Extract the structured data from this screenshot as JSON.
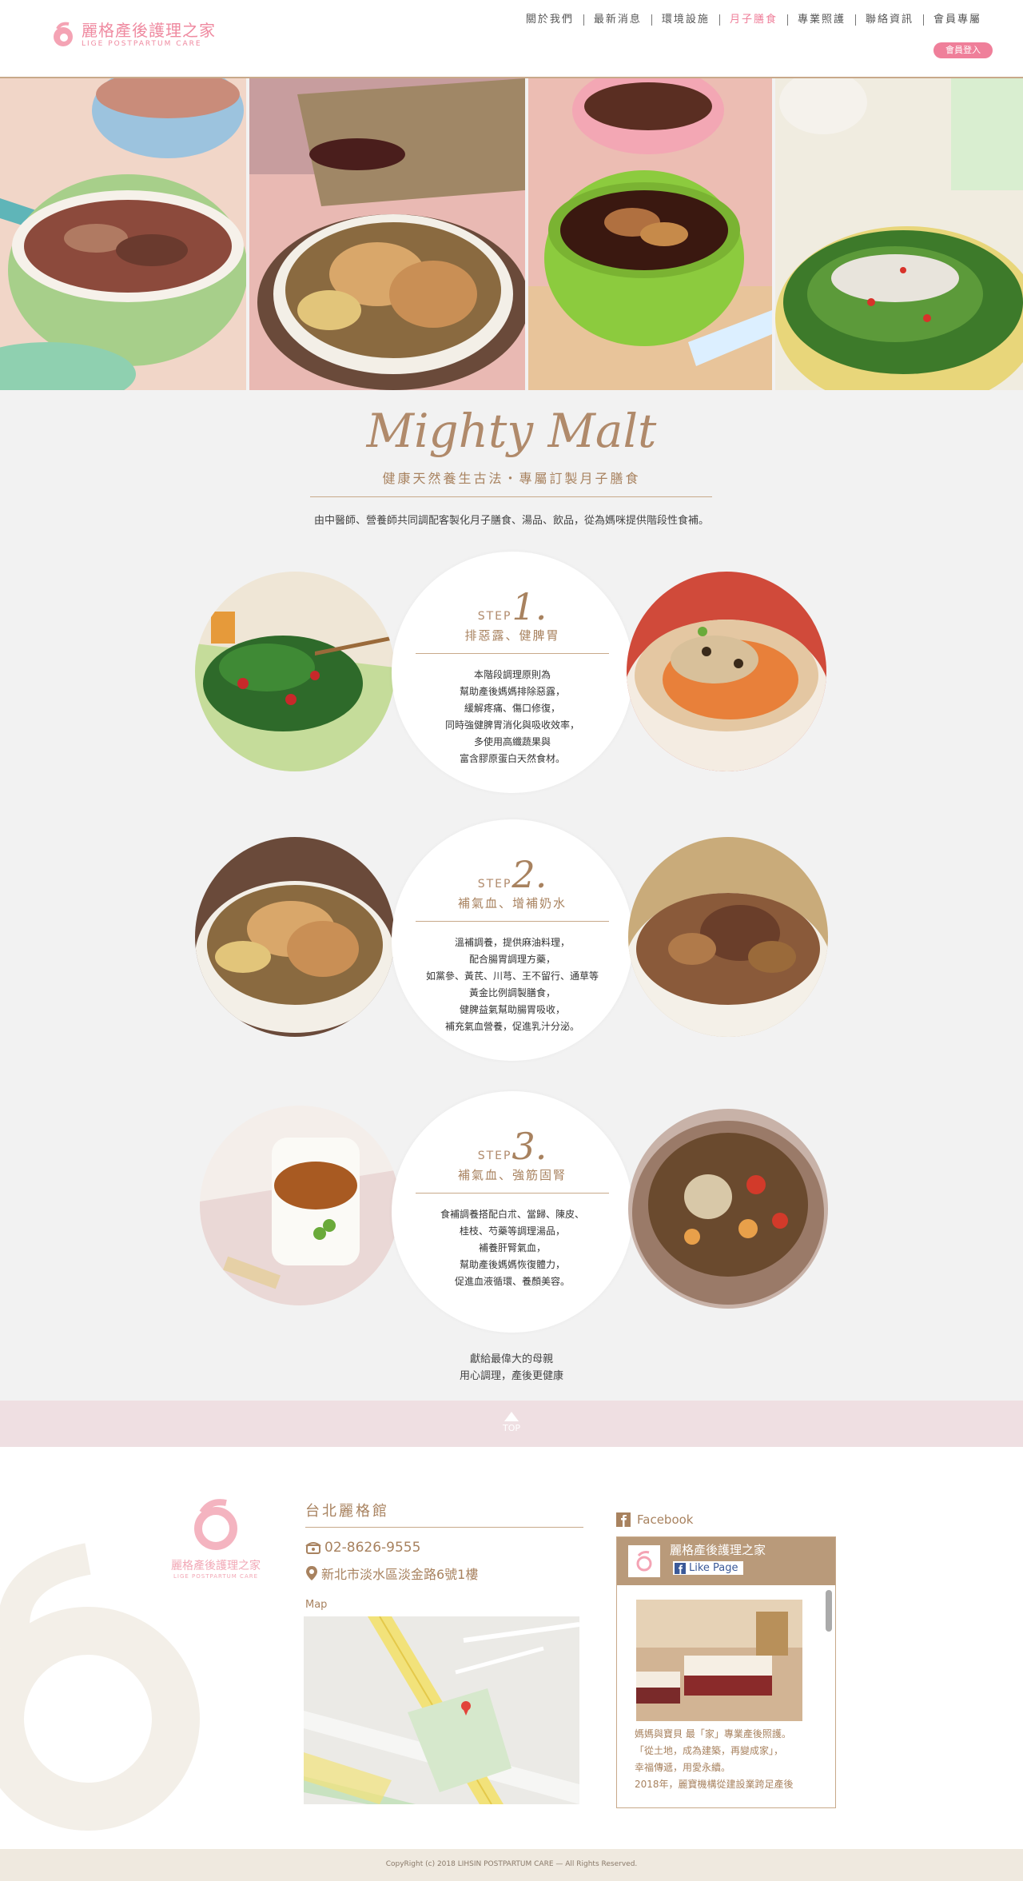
{
  "header": {
    "logo_cn": "麗格產後護理之家",
    "logo_en": "LIGE POSTPARTUM CARE",
    "nav": [
      {
        "label": "關於我們",
        "active": false
      },
      {
        "label": "最新消息",
        "active": false
      },
      {
        "label": "環境設施",
        "active": false
      },
      {
        "label": "月子膳食",
        "active": true
      },
      {
        "label": "專業照護",
        "active": false
      },
      {
        "label": "聯絡資訊",
        "active": false
      },
      {
        "label": "會員專屬",
        "active": false
      }
    ],
    "login_label": "會員登入"
  },
  "intro": {
    "script_title": "Mighty Malt",
    "subtitle": "健康天然養生古法・專屬訂製月子膳食",
    "description": "由中醫師、營養師共同調配客製化月子膳食、湯品、飲品，從為媽咪提供階段性食補。"
  },
  "steps": [
    {
      "step_word": "STEP",
      "number": "1.",
      "title": "排惡露、健脾胃",
      "body": [
        "本階段調理原則為",
        "幫助產後媽媽排除惡露，",
        "緩解疼痛、傷口修復，",
        "同時強健脾胃消化與吸收效率，",
        "多使用高纖蔬果與",
        "富含膠原蛋白天然食材。"
      ]
    },
    {
      "step_word": "STEP",
      "number": "2.",
      "title": "補氣血、增補奶水",
      "body": [
        "溫補調養，提供麻油料理，",
        "配合腸胃調理方藥，",
        "如黨參、黃芪、川芎、王不留行、通草等",
        "黃金比例調製膳食，",
        "健脾益氣幫助腸胃吸收，",
        "補充氣血營養，促進乳汁分泌。"
      ]
    },
    {
      "step_word": "STEP",
      "number": "3.",
      "title": "補氣血、強筋固腎",
      "body": [
        "食補調養搭配白朮、當歸、陳皮、",
        "桂枝、芍藥等調理湯品，",
        "補養肝腎氣血，",
        "幫助產後媽媽恢復體力，",
        "促進血液循環、養顏美容。"
      ]
    }
  ],
  "closing": [
    "獻給最偉大的母親",
    "用心調理，產後更健康"
  ],
  "top_label": "TOP",
  "footer": {
    "logo_cn": "麗格產後護理之家",
    "logo_en": "LIGE POSTPARTUM CARE",
    "branch": "台北麗格館",
    "phone": "02-8626-9555",
    "address": "新北市淡水區淡金路6號1樓",
    "map_label": "Map",
    "facebook_label": "Facebook",
    "fb_page_name": "麗格產後護理之家",
    "fb_like": "Like Page",
    "fb_post": [
      "媽媽與寶貝 最「家」專業產後照護。",
      "「從土地，成為建築，再變成家」，",
      "幸福傳遞，用愛永續。",
      "2018年，麗寶機構從建設業跨足產後"
    ]
  },
  "copyright": "CopyRight (c) 2018  LIHSIN POSTPARTUM CARE — All Rights Reserved.",
  "colors": {
    "accent": "#ef7f9a",
    "brand_brown": "#a8825f",
    "line": "#c8a98a"
  }
}
